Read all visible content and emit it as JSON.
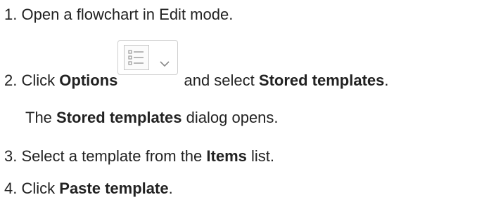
{
  "steps": [
    {
      "number": "1.",
      "text": "Open a flowchart in Edit mode."
    },
    {
      "number": "2.",
      "prefix": "Click ",
      "button_label": "Options",
      "middle": " and select ",
      "target": "Stored templates",
      "suffix": "."
    },
    {
      "note_prefix": "The ",
      "note_bold": "Stored templates",
      "note_suffix": " dialog opens."
    },
    {
      "number": "3.",
      "prefix": "Select a template from the ",
      "bold": "Items",
      "suffix": " list."
    },
    {
      "number": "4.",
      "prefix": "Click ",
      "bold": "Paste template",
      "suffix": "."
    }
  ],
  "icons": {
    "options_icon": "list-options-icon",
    "dropdown_icon": "chevron-down-icon"
  },
  "colors": {
    "text": "#222222",
    "button_border": "#cfcfcf",
    "icon_stroke": "#9a9a9a"
  }
}
